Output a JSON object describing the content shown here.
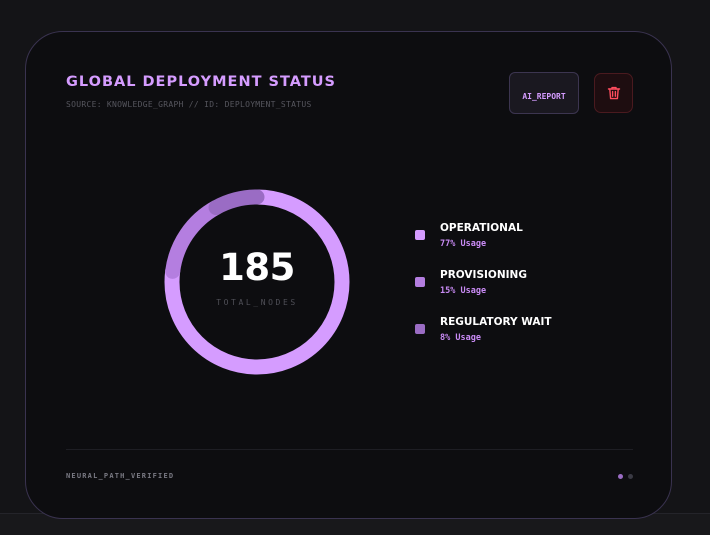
{
  "card": {
    "title": "GLOBAL DEPLOYMENT STATUS",
    "subtitle": "SOURCE: KNOWLEDGE_GRAPH // ID: DEPLOYMENT_STATUS",
    "ai_button_label": "AI_REPORT",
    "delete_icon": "trash-icon",
    "footer": "NEURAL_PATH_VERIFIED",
    "pager": {
      "count": 2,
      "active": 0
    }
  },
  "chart_data": {
    "type": "pie",
    "center_value": "185",
    "center_label": "TOTAL_NODES",
    "categories": [
      "OPERATIONAL",
      "PROVISIONING",
      "REGULATORY WAIT"
    ],
    "values": [
      77,
      15,
      8
    ],
    "labels": [
      "77% Usage",
      "15% Usage",
      "8% Usage"
    ],
    "colors": [
      "#d59cff",
      "#b47ee0",
      "#9a6cc4"
    ]
  },
  "colors": {
    "accent": "#d59cff",
    "danger": "#ff4d5e",
    "background": "#0d0d10"
  }
}
